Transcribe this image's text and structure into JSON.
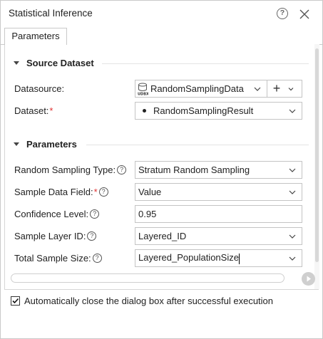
{
  "window": {
    "title": "Statistical Inference",
    "help_glyph": "?"
  },
  "tabs": [
    {
      "label": "Parameters",
      "active": true
    }
  ],
  "source_dataset": {
    "heading": "Source Dataset",
    "datasource_label": "Datasource:",
    "datasource_value": "RandomSamplingData",
    "datasource_icon": "udbx-datasource-icon",
    "add_glyph": "+",
    "dataset_label": "Dataset:",
    "dataset_required": "*",
    "dataset_value": "RandomSamplingResult"
  },
  "parameters": {
    "heading": "Parameters",
    "fields": [
      {
        "label": "Random Sampling Type:",
        "required": "",
        "help": true,
        "value": "Stratum Random Sampling",
        "kind": "select"
      },
      {
        "label": "Sample Data Field:",
        "required": "*",
        "help": true,
        "value": "Value",
        "kind": "select"
      },
      {
        "label": "Confidence Level:",
        "required": "",
        "help": true,
        "value": "0.95",
        "kind": "text"
      },
      {
        "label": "Sample Layer ID:",
        "required": "",
        "help": true,
        "value": "Layered_ID",
        "kind": "select"
      },
      {
        "label": "Total Sample Size:",
        "required": "",
        "help": true,
        "value": "Layered_PopulationSize",
        "kind": "select"
      }
    ]
  },
  "footer": {
    "auto_close_label": "Automatically close the dialog box after successful execution",
    "auto_close_checked": true
  },
  "colors": {
    "border": "#c4c4c4",
    "required": "#e03030",
    "run_button": "#cfcfcf"
  }
}
